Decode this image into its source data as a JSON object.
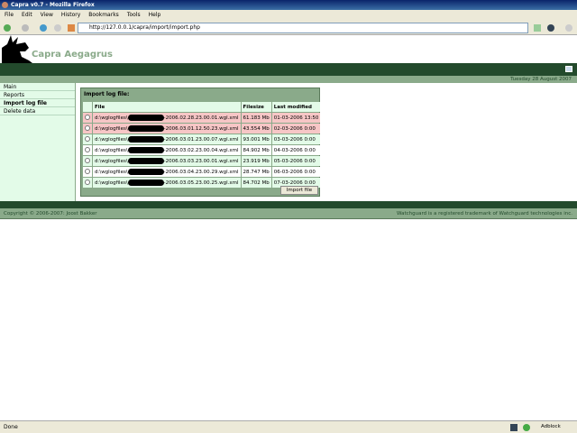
{
  "window": {
    "title": "Capra v0.7 - Mozilla Firefox"
  },
  "menu": [
    "File",
    "Edit",
    "View",
    "History",
    "Bookmarks",
    "Tools",
    "Help"
  ],
  "address": {
    "url": "http://127.0.0.1/capra/import/import.php"
  },
  "site": {
    "brand": "Capra Aegagrus",
    "date": "Tuesday 28 August 2007"
  },
  "sidebar": {
    "items": [
      {
        "label": "Main"
      },
      {
        "label": "Reports"
      },
      {
        "label": "Import log file"
      },
      {
        "label": "Delete data"
      }
    ]
  },
  "panel": {
    "title": "Import log file:",
    "headers": {
      "file": "File",
      "filesize": "Filesize",
      "modified": "Last modified"
    },
    "rows": [
      {
        "prefix": "d:\\wglogfiles\\",
        "suffix": "-2006.02.28.23.00.01.wgl.xml",
        "size": "61.183 Mb",
        "modified": "01-03-2006 13:50"
      },
      {
        "prefix": "d:\\wglogfiles\\",
        "suffix": "-2006.03.01.12.50.23.wgl.xml",
        "size": "43.554 Mb",
        "modified": "02-03-2006 0:00"
      },
      {
        "prefix": "d:\\wglogfiles\\",
        "suffix": "-2006.03.01.23.00.07.wgl.xml",
        "size": "93.001 Mb",
        "modified": "03-03-2006 0:00"
      },
      {
        "prefix": "d:\\wglogfiles\\",
        "suffix": "-2006.03.02.23.00.04.wgl.xml",
        "size": "84.902 Mb",
        "modified": "04-03-2006 0:00"
      },
      {
        "prefix": "d:\\wglogfiles\\",
        "suffix": "-2006.03.03.23.00.01.wgl.xml",
        "size": "23.919 Mb",
        "modified": "05-03-2006 0:00"
      },
      {
        "prefix": "d:\\wglogfiles\\",
        "suffix": "-2006.03.04.23.00.29.wgl.xml",
        "size": "28.747 Mb",
        "modified": "06-03-2006 0:00"
      },
      {
        "prefix": "d:\\wglogfiles\\",
        "suffix": "-2006.03.05.23.00.25.wgl.xml",
        "size": "84.702 Mb",
        "modified": "07-03-2006 0:00"
      }
    ],
    "button": "Import file"
  },
  "footer": {
    "left": "Copyright © 2006-2007: Joost Bakker",
    "right": "Watchguard is a registered trademark of Watchguard technologies inc."
  },
  "status": {
    "text": "Done",
    "adblock": "Adblock"
  }
}
